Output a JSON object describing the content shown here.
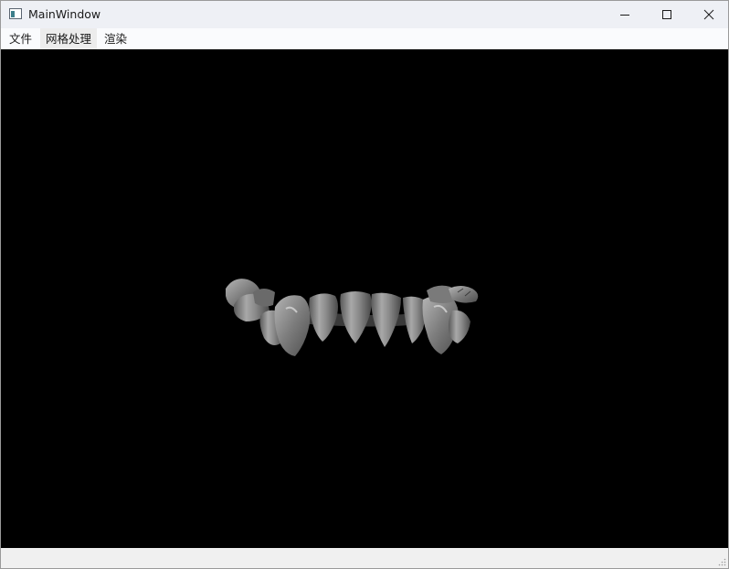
{
  "window": {
    "title": "MainWindow"
  },
  "menu": {
    "items": [
      {
        "label": "文件"
      },
      {
        "label": "网格处理"
      },
      {
        "label": "渲染"
      }
    ]
  },
  "viewport": {
    "background": "#000000",
    "content": "3d-dental-mesh"
  },
  "colors": {
    "titlebar": "#eef0f5",
    "menubar": "#fafbfd",
    "mesh": "#8c8c8c"
  },
  "icons": {
    "app": "app-icon",
    "minimize": "minimize-icon",
    "maximize": "maximize-icon",
    "close": "close-icon",
    "grip": "size-grip-icon"
  }
}
